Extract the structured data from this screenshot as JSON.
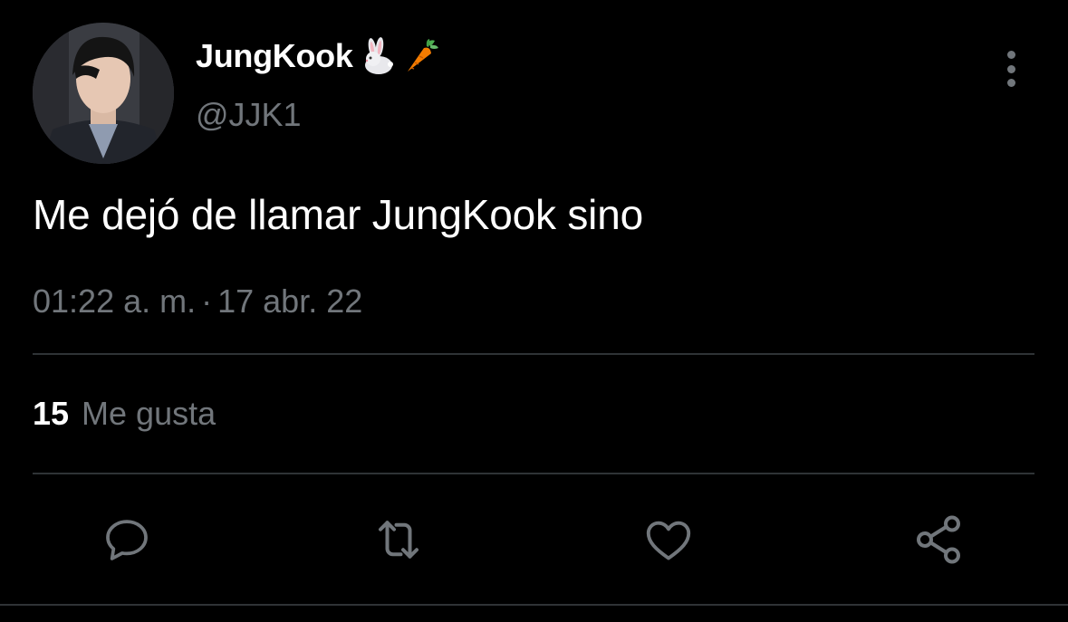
{
  "author": {
    "display_name": "JungKook",
    "name_emojis": [
      "rabbit-emoji",
      "carrot-emoji"
    ],
    "handle": "@JJK1"
  },
  "tweet": {
    "text": "Me dejó de llamar JungKook sino",
    "time": "01:22 a. m.",
    "separator": "·",
    "date": "17 abr. 22"
  },
  "stats": {
    "likes_count": "15",
    "likes_label": "Me gusta"
  },
  "actions": [
    "reply-icon",
    "retweet-icon",
    "like-icon",
    "share-icon"
  ],
  "colors": {
    "background": "#000000",
    "primary_text": "#ffffff",
    "secondary_text": "#71767b",
    "divider": "#2f3336"
  }
}
